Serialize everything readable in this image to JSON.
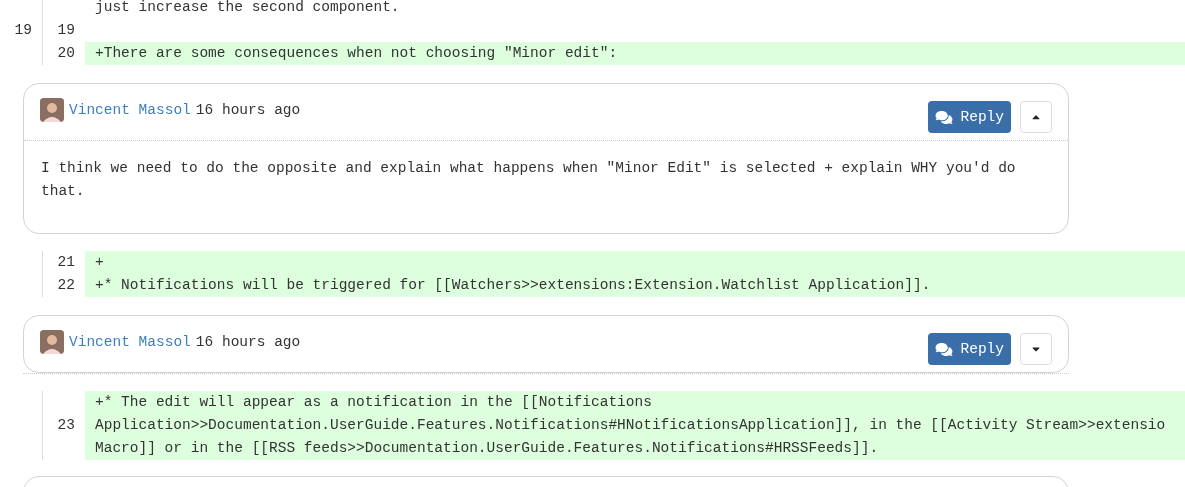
{
  "blocks": [
    {
      "kind": "line",
      "added": false,
      "segments": [
        "just increase the second component."
      ]
    },
    {
      "kind": "line",
      "old": "19",
      "new": "19",
      "added": false
    },
    {
      "kind": "line",
      "new": "20",
      "added": true,
      "segments": [
        "+There are some consequences when not choosing \"Minor edit\":"
      ]
    },
    {
      "kind": "comment",
      "author": "Vincent Massol",
      "time": "16 hours ago",
      "reply": "Reply",
      "expanded": true,
      "body": "I think we need to do the opposite and explain what happens when \"Minor Edit\" is selected + explain WHY you'd do that."
    },
    {
      "kind": "line",
      "new": "21",
      "added": true,
      "segments": [
        "+"
      ]
    },
    {
      "kind": "line",
      "new": "22",
      "added": true,
      "segments": [
        "+* Notifications will be triggered for [[Watchers>>extensions:Extension.Watchlist Application]]."
      ]
    },
    {
      "kind": "comment",
      "author": "Vincent Massol",
      "time": "16 hours ago",
      "reply": "Reply",
      "expanded": false
    },
    {
      "kind": "line",
      "new": "23",
      "added": true,
      "segments": [
        "+* The edit will appear as a notification in the [[Notifications",
        "Application>>Documentation.UserGuide.Features.Notifications#HNotificationsApplication]], in the [[Activity Stream>>extensio",
        "Macro]] or in the [[RSS feeds>>Documentation.UserGuide.Features.Notifications#HRSSFeeds]]."
      ]
    }
  ]
}
